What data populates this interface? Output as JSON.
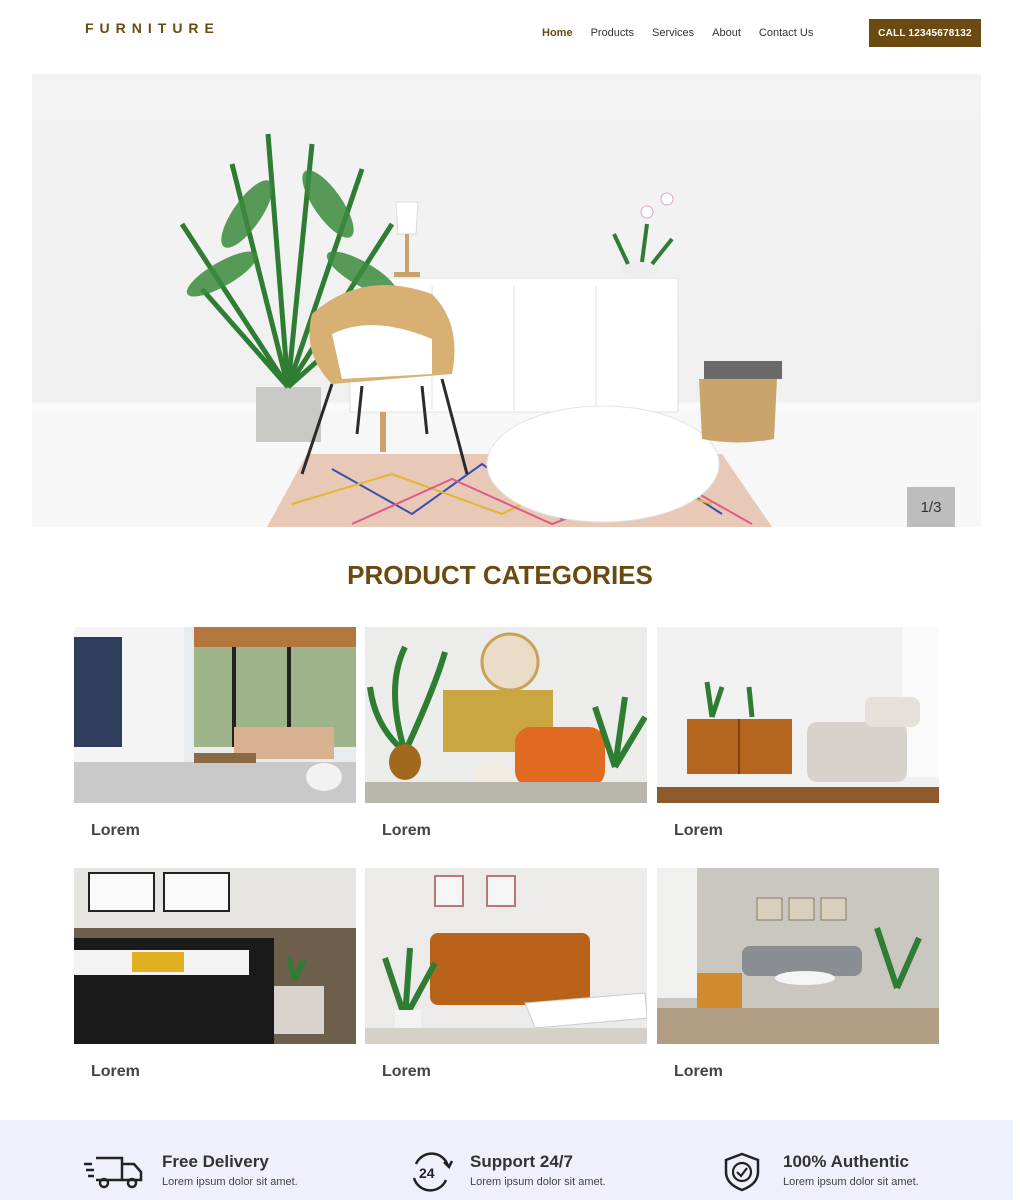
{
  "header": {
    "logo": "FURNITURE",
    "nav": [
      "Home",
      "Products",
      "Services",
      "About",
      "Contact Us"
    ],
    "call_button": "CALL 12345678132"
  },
  "hero": {
    "slide_counter": "1/3"
  },
  "categories": {
    "title": "PRODUCT CATEGORIES",
    "items": [
      {
        "label": "Lorem"
      },
      {
        "label": "Lorem"
      },
      {
        "label": "Lorem"
      },
      {
        "label": "Lorem"
      },
      {
        "label": "Lorem"
      },
      {
        "label": "Lorem"
      }
    ]
  },
  "features": [
    {
      "icon": "delivery-truck-icon",
      "title": "Free Delivery",
      "desc": "Lorem ipsum dolor sit amet."
    },
    {
      "icon": "support-24-icon",
      "title": "Support 24/7",
      "desc": "Lorem ipsum dolor sit amet."
    },
    {
      "icon": "shield-check-icon",
      "title": "100% Authentic",
      "desc": "Lorem ipsum dolor sit amet."
    }
  ],
  "colors": {
    "brand": "#6b4a12",
    "feature_bg": "#eef1fb"
  }
}
